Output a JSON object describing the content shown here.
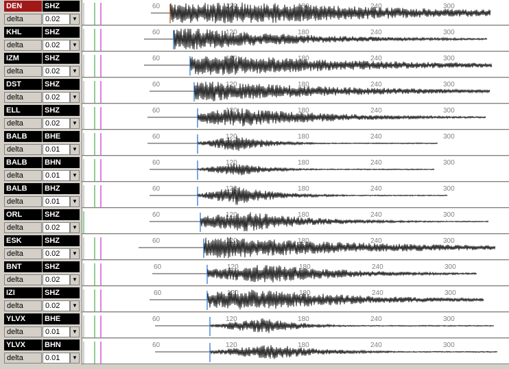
{
  "delta_label": "delta",
  "spin_glyph": "▼",
  "rows": [
    {
      "station": "DEN",
      "channel": "SHZ",
      "delta": "0.02",
      "selected": true
    },
    {
      "station": "KHL",
      "channel": "SHZ",
      "delta": "0.02"
    },
    {
      "station": "IZM",
      "channel": "SHZ",
      "delta": "0.02"
    },
    {
      "station": "DST",
      "channel": "SHZ",
      "delta": "0.02"
    },
    {
      "station": "ELL",
      "channel": "SHZ",
      "delta": "0.02"
    },
    {
      "station": "BALB",
      "channel": "BHE",
      "delta": "0.01"
    },
    {
      "station": "BALB",
      "channel": "BHN",
      "delta": "0.01"
    },
    {
      "station": "BALB",
      "channel": "BHZ",
      "delta": "0.01"
    },
    {
      "station": "ORL",
      "channel": "SHZ",
      "delta": "0.02"
    },
    {
      "station": "ESK",
      "channel": "SHZ",
      "delta": "0.02"
    },
    {
      "station": "BNT",
      "channel": "SHZ",
      "delta": "0.02"
    },
    {
      "station": "IZI",
      "channel": "SHZ",
      "delta": "0.02"
    },
    {
      "station": "YLVX",
      "channel": "BHE",
      "delta": "0.01"
    },
    {
      "station": "YLVX",
      "channel": "BHN",
      "delta": "0.01"
    }
  ],
  "tick_labels": [
    "60",
    "120",
    "180",
    "240",
    "300"
  ],
  "colors": {
    "selected_station": "#a01818",
    "green_marker": "#2a9a2a",
    "magenta_marker": "#c000c0",
    "pick_line": "#1e6fd0"
  }
}
